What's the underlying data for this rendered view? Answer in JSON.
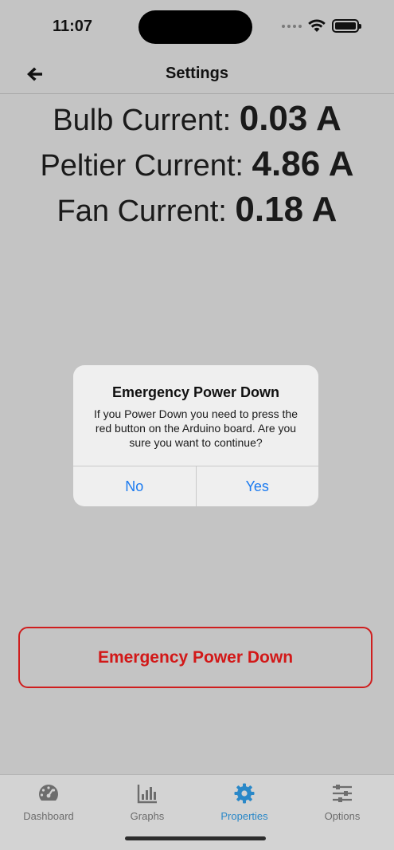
{
  "status_bar": {
    "time": "11:07"
  },
  "nav": {
    "title": "Settings"
  },
  "readings": [
    {
      "label": "Bulb Current: ",
      "value": "0.03 A"
    },
    {
      "label": "Peltier Current: ",
      "value": "4.86 A"
    },
    {
      "label": "Fan Current: ",
      "value": "0.18 A"
    }
  ],
  "alert": {
    "title": "Emergency Power Down",
    "message": "If you Power Down you need to press the red button on the Arduino board. Are you sure you want to continue?",
    "no_label": "No",
    "yes_label": "Yes"
  },
  "emergency_button": {
    "label": "Emergency Power Down",
    "color": "#d21818"
  },
  "tabs": [
    {
      "label": "Dashboard",
      "icon": "dashboard-gauge-icon"
    },
    {
      "label": "Graphs",
      "icon": "bar-chart-icon"
    },
    {
      "label": "Properties",
      "icon": "gear-icon",
      "active": true
    },
    {
      "label": "Options",
      "icon": "sliders-icon"
    }
  ],
  "colors": {
    "accent": "#1a7af0",
    "active_tab": "#2a88c8",
    "danger": "#d21818",
    "background": "#c4c4c4"
  }
}
